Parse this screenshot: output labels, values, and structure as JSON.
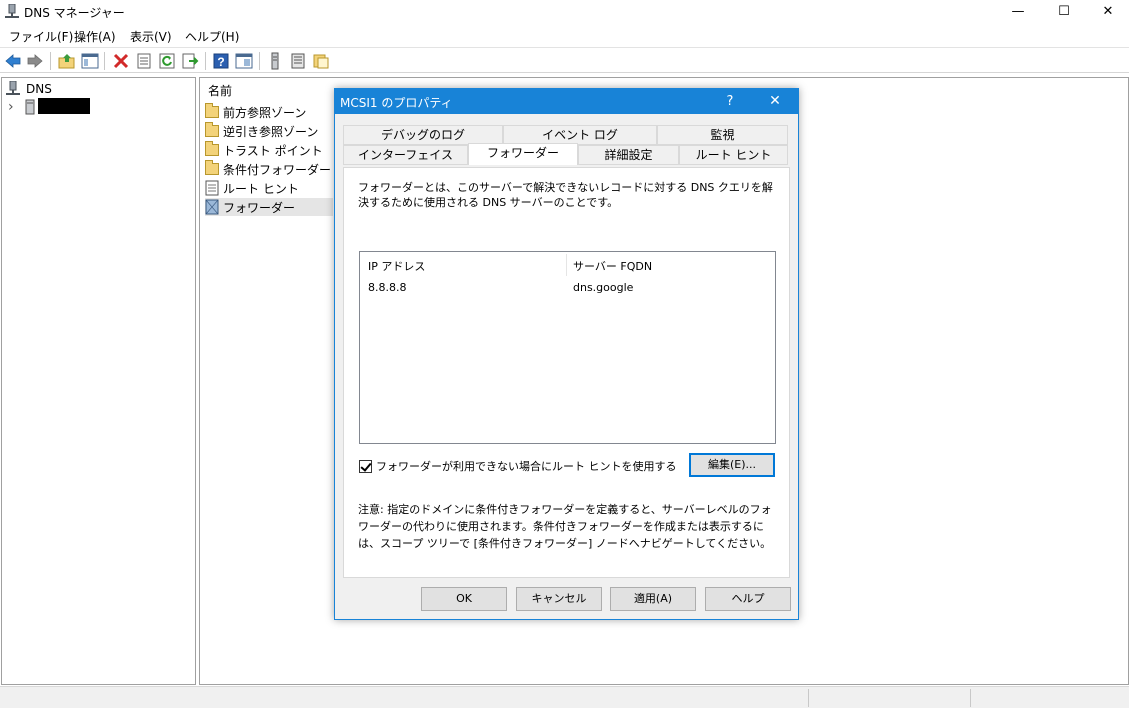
{
  "window": {
    "title": "DNS マネージャー",
    "minimize": "—",
    "maximize": "☐",
    "close": "✕"
  },
  "menu": [
    {
      "label": "ファイル(F)"
    },
    {
      "label": "操作(A)"
    },
    {
      "label": "表示(V)"
    },
    {
      "label": "ヘルプ(H)"
    }
  ],
  "tree": {
    "root_label": "DNS",
    "expander": "›"
  },
  "list": {
    "header": "名前",
    "items": [
      {
        "label": "前方参照ゾーン"
      },
      {
        "label": "逆引き参照ゾーン"
      },
      {
        "label": "トラスト ポイント"
      },
      {
        "label": "条件付フォワーダー"
      },
      {
        "label": "ルート ヒント"
      },
      {
        "label": "フォワーダー"
      }
    ]
  },
  "dialog": {
    "title": "MCSI1 のプロパティ",
    "help_button": "?",
    "close_button": "✕",
    "tabs_row1": [
      "デバッグのログ",
      "イベント ログ",
      "監視"
    ],
    "tabs_row2": [
      "インターフェイス",
      "フォワーダー",
      "詳細設定",
      "ルート ヒント"
    ],
    "description": "フォワーダーとは、このサーバーで解決できないレコードに対する DNS クエリを解決するために使用される DNS サーバーのことです。",
    "grid": {
      "columns": [
        "IP アドレス",
        "サーバー FQDN"
      ],
      "rows": [
        {
          "ip": "8.8.8.8",
          "fqdn": "dns.google"
        }
      ]
    },
    "checkbox_label": "フォワーダーが利用できない場合にルート ヒントを使用する",
    "edit_button": "編集(E)...",
    "note": "注意: 指定のドメインに条件付きフォワーダーを定義すると、サーバーレベルのフォワーダーの代わりに使用されます。条件付きフォワーダーを作成または表示するには、スコープ ツリーで [条件付きフォワーダー] ノードへナビゲートしてください。",
    "buttons": {
      "ok": "OK",
      "cancel": "キャンセル",
      "apply": "適用(A)",
      "help": "ヘルプ"
    }
  }
}
